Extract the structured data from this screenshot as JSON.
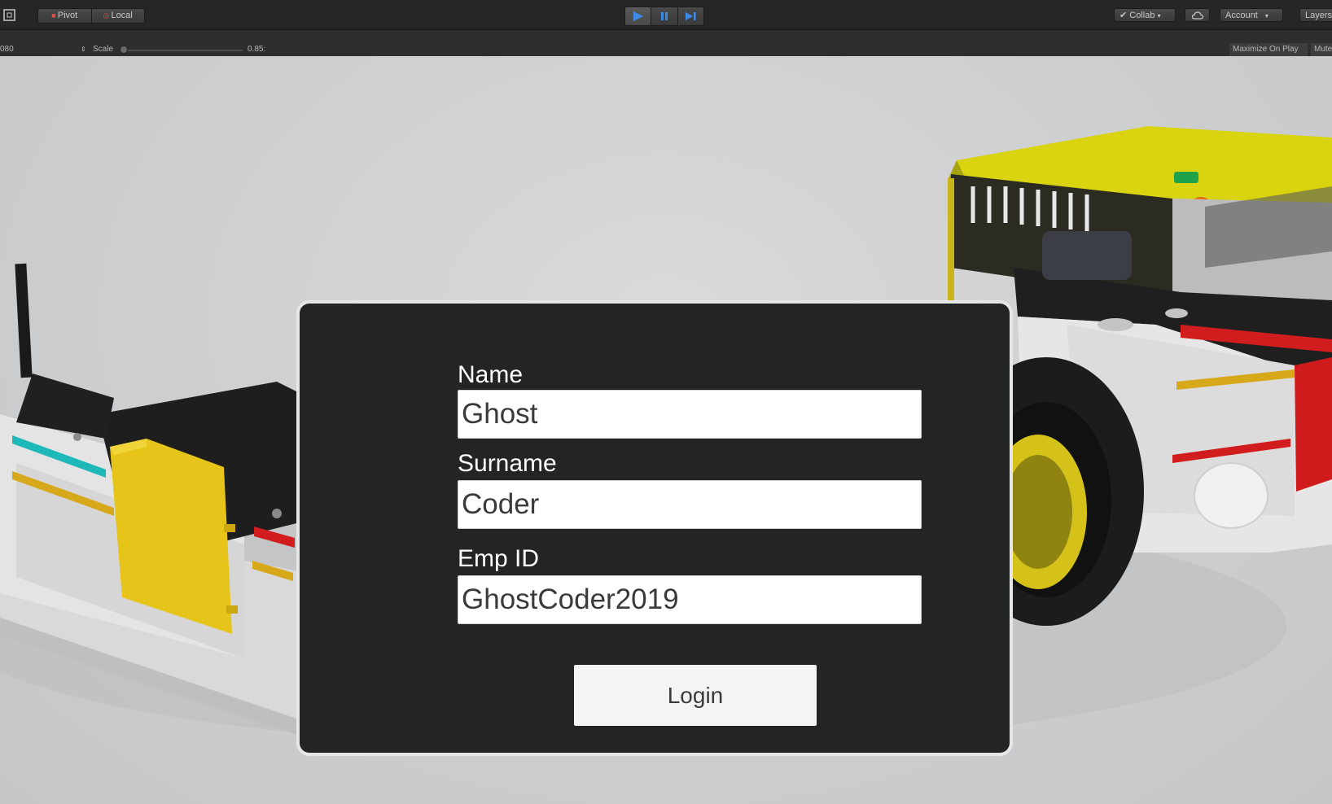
{
  "toolbar": {
    "pivot_label": "Pivot",
    "local_label": "Local",
    "collab_label": "Collab",
    "account_label": "Account",
    "layers_label": "Layers"
  },
  "game_view": {
    "resolution_label": "080",
    "scale_label": "Scale",
    "scale_value": "0.85:",
    "maximize_label": "Maximize On Play",
    "mute_label": "Mute"
  },
  "login": {
    "name_label": "Name",
    "name_value": "Ghost",
    "surname_label": "Surname",
    "surname_value": "Coder",
    "empid_label": "Emp ID",
    "empid_value": "GhostCoder2019",
    "login_button": "Login"
  },
  "colors": {
    "panel_bg": "#222523",
    "panel_border": "#e6e6e6",
    "play_blue": "#3d8be8",
    "vehicle_yellow": "#e6c419",
    "vehicle_red": "#d11d1d"
  }
}
